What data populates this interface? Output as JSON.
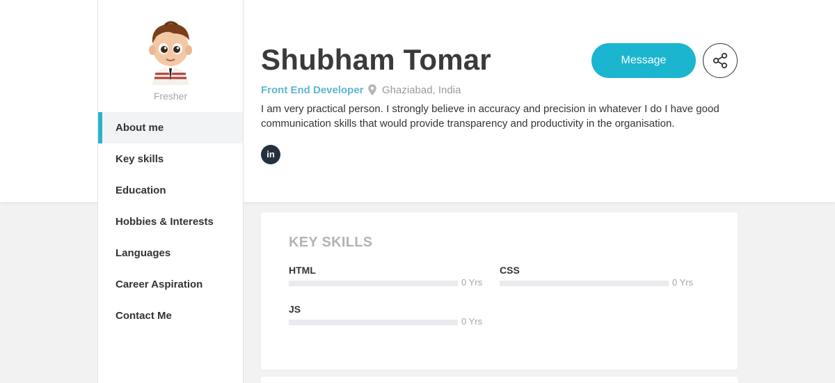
{
  "profile": {
    "name": "Shubham Tomar",
    "role": "Front End Developer",
    "location": "Ghaziabad, India",
    "status": "Fresher",
    "about": "I am very practical person. I strongly believe in accuracy and precision in whatever I do I have good communication skills that would provide transparency and productivity in the organisation.",
    "linkedin_icon": "in"
  },
  "actions": {
    "message_label": "Message",
    "share_icon": "share-icon"
  },
  "sidebar": {
    "items": [
      {
        "label": "About me",
        "active": true
      },
      {
        "label": "Key skills",
        "active": false
      },
      {
        "label": "Education",
        "active": false
      },
      {
        "label": "Hobbies & Interests",
        "active": false
      },
      {
        "label": "Languages",
        "active": false
      },
      {
        "label": "Career Aspiration",
        "active": false
      },
      {
        "label": "Contact Me",
        "active": false
      }
    ]
  },
  "key_skills": {
    "title": "KEY SKILLS",
    "skills": [
      {
        "name": "HTML",
        "years": "0 Yrs",
        "level": 0
      },
      {
        "name": "CSS",
        "years": "0 Yrs",
        "level": 0
      },
      {
        "name": "JS",
        "years": "0 Yrs",
        "level": 0
      }
    ]
  },
  "colors": {
    "accent": "#1cb5cf",
    "role_text": "#5fb6ce",
    "active_border": "#2bb3c9",
    "linkedin_bg": "#24303f"
  }
}
